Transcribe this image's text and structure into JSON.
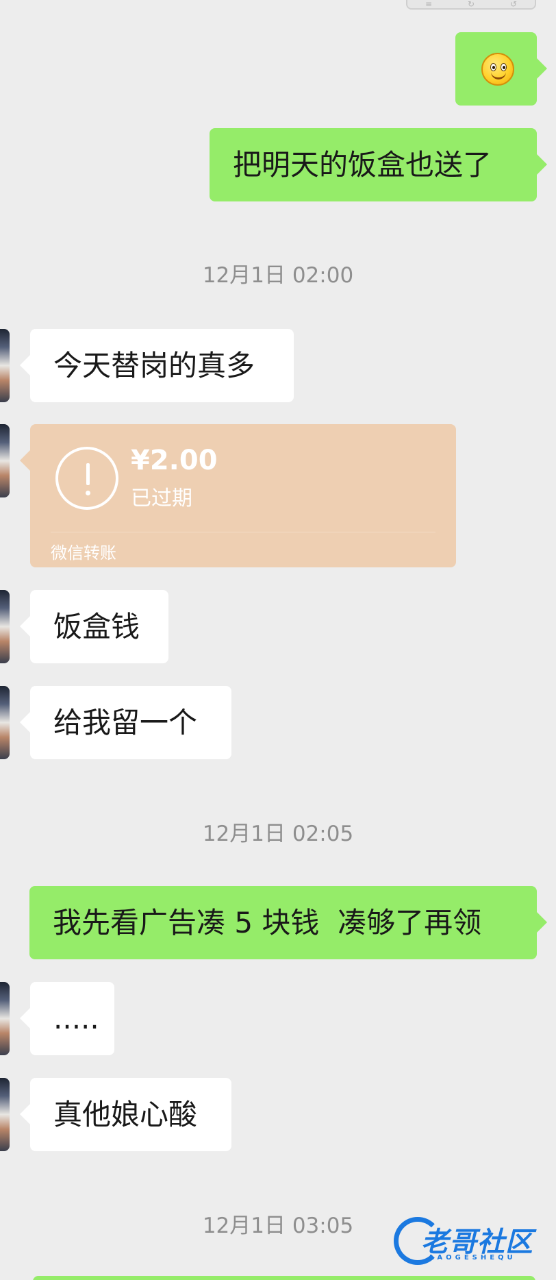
{
  "toolbar": {
    "btn1": "≡",
    "btn2": "↻",
    "btn3": "↺"
  },
  "messages": {
    "m1_emoji": "smiley-face",
    "m2": "把明天的饭盒也送了",
    "ts1": "12月1日 02:00",
    "m3": "今天替岗的真多",
    "transfer": {
      "amount": "¥2.00",
      "status": "已过期",
      "source": "微信转账",
      "color": "#eecfb2"
    },
    "m4": "饭盒钱",
    "m5": "给我留一个",
    "ts2": "12月1日 02:05",
    "m6": "我先看广告凑 5 块钱  凑够了再领",
    "m7": ".....",
    "m8": "真他娘心酸",
    "ts3": "12月1日 03:05"
  },
  "watermark": {
    "title": "老哥社区",
    "sub": "LAOGESHEQU"
  },
  "colors": {
    "sent": "#95ec69",
    "received": "#ffffff",
    "background": "#ededed",
    "brand": "#1b79e0"
  }
}
